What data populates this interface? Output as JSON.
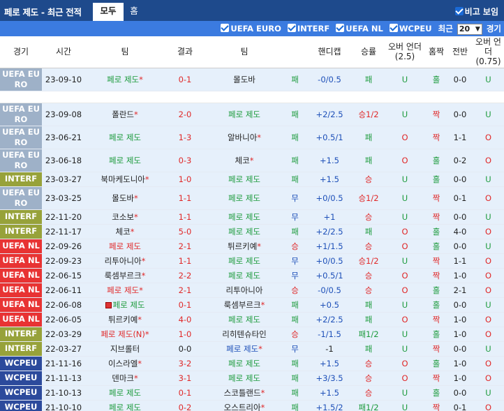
{
  "header": {
    "title": "페로 제도 - 최근 전적",
    "tabs": [
      "모두",
      "홈"
    ],
    "hide_compare_label": "비고 보임"
  },
  "filters": {
    "items": [
      "UEFA EURO",
      "INTERF",
      "UEFA NL",
      "WCPEU"
    ],
    "recent_label": "최근",
    "count_value": "20",
    "games_label": "경기"
  },
  "columns": [
    "경기",
    "시간",
    "팀",
    "결과",
    "팀",
    "핸디캡",
    "승률",
    "오버 언더 (2.5)",
    "홈짝",
    "전반",
    "오버 언더 (0.75)"
  ],
  "league_colors": {
    "UEFA EURO": "#9eb1c8",
    "INTERF": "#97a23a",
    "UEFA NL": "#e83333",
    "WCPEU": "#2c4a9c"
  },
  "matches": [
    {
      "league": "UEFA EURO",
      "date": "23-09-10",
      "home": "페로 제도",
      "home_mark": "*",
      "home_color": "g",
      "score": "0-1",
      "score_color": "r",
      "away": "몰도바",
      "away_mark": "",
      "away_color": "k",
      "res": "패",
      "res_color": "g",
      "handicap": "-0/0.5",
      "hc_color": "b",
      "win": "패",
      "win_color": "g",
      "ou": "U",
      "ou_color": "g",
      "oe": "홀",
      "oe_color": "g",
      "half": "0-0",
      "half_color": "k",
      "ou2": "U",
      "ou2_color": "g",
      "gap_after": true
    },
    {
      "league": "UEFA EURO",
      "date": "23-09-08",
      "home": "폴란드",
      "home_mark": "*",
      "home_color": "k",
      "score": "2-0",
      "score_color": "r",
      "away": "페로 제도",
      "away_mark": "",
      "away_color": "g",
      "res": "패",
      "res_color": "g",
      "handicap": "+2/2.5",
      "hc_color": "b",
      "win": "승1/2",
      "win_color": "r",
      "ou": "U",
      "ou_color": "g",
      "oe": "짝",
      "oe_color": "r",
      "half": "0-0",
      "half_color": "k",
      "ou2": "U",
      "ou2_color": "g"
    },
    {
      "league": "UEFA EURO",
      "date": "23-06-21",
      "home": "페로 제도",
      "home_mark": "",
      "home_color": "g",
      "score": "1-3",
      "score_color": "r",
      "away": "알바니아",
      "away_mark": "*",
      "away_color": "k",
      "res": "패",
      "res_color": "g",
      "handicap": "+0.5/1",
      "hc_color": "b",
      "win": "패",
      "win_color": "g",
      "ou": "O",
      "ou_color": "r",
      "oe": "짝",
      "oe_color": "r",
      "half": "1-1",
      "half_color": "k",
      "ou2": "O",
      "ou2_color": "r"
    },
    {
      "league": "UEFA EURO",
      "date": "23-06-18",
      "home": "페로 제도",
      "home_mark": "",
      "home_color": "g",
      "score": "0-3",
      "score_color": "r",
      "away": "체코",
      "away_mark": "*",
      "away_color": "k",
      "res": "패",
      "res_color": "g",
      "handicap": "+1.5",
      "hc_color": "b",
      "win": "패",
      "win_color": "g",
      "ou": "O",
      "ou_color": "r",
      "oe": "홀",
      "oe_color": "g",
      "half": "0-2",
      "half_color": "k",
      "ou2": "O",
      "ou2_color": "r"
    },
    {
      "league": "INTERF",
      "date": "23-03-27",
      "home": "북마케도니아",
      "home_mark": "*",
      "home_color": "k",
      "score": "1-0",
      "score_color": "r",
      "away": "페로 제도",
      "away_mark": "",
      "away_color": "g",
      "res": "패",
      "res_color": "g",
      "handicap": "+1.5",
      "hc_color": "b",
      "win": "승",
      "win_color": "r",
      "ou": "U",
      "ou_color": "g",
      "oe": "홀",
      "oe_color": "g",
      "half": "0-0",
      "half_color": "k",
      "ou2": "U",
      "ou2_color": "g"
    },
    {
      "league": "UEFA EURO",
      "date": "23-03-25",
      "home": "몰도바",
      "home_mark": "*",
      "home_color": "k",
      "score": "1-1",
      "score_color": "r",
      "away": "페로 제도",
      "away_mark": "",
      "away_color": "g",
      "res": "무",
      "res_color": "b",
      "handicap": "+0/0.5",
      "hc_color": "b",
      "win": "승1/2",
      "win_color": "r",
      "ou": "U",
      "ou_color": "g",
      "oe": "짝",
      "oe_color": "r",
      "half": "0-1",
      "half_color": "k",
      "ou2": "O",
      "ou2_color": "r"
    },
    {
      "league": "INTERF",
      "date": "22-11-20",
      "home": "코소보",
      "home_mark": "*",
      "home_color": "k",
      "score": "1-1",
      "score_color": "r",
      "away": "페로 제도",
      "away_mark": "",
      "away_color": "g",
      "res": "무",
      "res_color": "b",
      "handicap": "+1",
      "hc_color": "b",
      "win": "승",
      "win_color": "r",
      "ou": "U",
      "ou_color": "g",
      "oe": "짝",
      "oe_color": "r",
      "half": "0-0",
      "half_color": "k",
      "ou2": "U",
      "ou2_color": "g"
    },
    {
      "league": "INTERF",
      "date": "22-11-17",
      "home": "체코",
      "home_mark": "*",
      "home_color": "k",
      "score": "5-0",
      "score_color": "r",
      "away": "페로 제도",
      "away_mark": "",
      "away_color": "g",
      "res": "패",
      "res_color": "g",
      "handicap": "+2/2.5",
      "hc_color": "b",
      "win": "패",
      "win_color": "g",
      "ou": "O",
      "ou_color": "r",
      "oe": "홀",
      "oe_color": "g",
      "half": "4-0",
      "half_color": "k",
      "ou2": "O",
      "ou2_color": "r"
    },
    {
      "league": "UEFA NL",
      "date": "22-09-26",
      "home": "페로 제도",
      "home_mark": "",
      "home_color": "r",
      "score": "2-1",
      "score_color": "r",
      "away": "튀르키예",
      "away_mark": "*",
      "away_color": "k",
      "res": "승",
      "res_color": "r",
      "handicap": "+1/1.5",
      "hc_color": "b",
      "win": "승",
      "win_color": "r",
      "ou": "O",
      "ou_color": "r",
      "oe": "홀",
      "oe_color": "g",
      "half": "0-0",
      "half_color": "k",
      "ou2": "U",
      "ou2_color": "g"
    },
    {
      "league": "UEFA NL",
      "date": "22-09-23",
      "home": "리투아니아",
      "home_mark": "*",
      "home_color": "k",
      "score": "1-1",
      "score_color": "r",
      "away": "페로 제도",
      "away_mark": "",
      "away_color": "g",
      "res": "무",
      "res_color": "b",
      "handicap": "+0/0.5",
      "hc_color": "b",
      "win": "승1/2",
      "win_color": "r",
      "ou": "U",
      "ou_color": "g",
      "oe": "짝",
      "oe_color": "r",
      "half": "1-1",
      "half_color": "k",
      "ou2": "O",
      "ou2_color": "r"
    },
    {
      "league": "UEFA NL",
      "date": "22-06-15",
      "home": "룩셈부르크",
      "home_mark": "*",
      "home_color": "k",
      "score": "2-2",
      "score_color": "r",
      "away": "페로 제도",
      "away_mark": "",
      "away_color": "g",
      "res": "무",
      "res_color": "b",
      "handicap": "+0.5/1",
      "hc_color": "b",
      "win": "승",
      "win_color": "r",
      "ou": "O",
      "ou_color": "r",
      "oe": "짝",
      "oe_color": "r",
      "half": "1-0",
      "half_color": "k",
      "ou2": "O",
      "ou2_color": "r"
    },
    {
      "league": "UEFA NL",
      "date": "22-06-11",
      "home": "페로 제도",
      "home_mark": "*",
      "home_color": "r",
      "score": "2-1",
      "score_color": "r",
      "away": "리투아니아",
      "away_mark": "",
      "away_color": "k",
      "res": "승",
      "res_color": "r",
      "handicap": "-0/0.5",
      "hc_color": "b",
      "win": "승",
      "win_color": "r",
      "ou": "O",
      "ou_color": "r",
      "oe": "홀",
      "oe_color": "g",
      "half": "2-1",
      "half_color": "k",
      "ou2": "O",
      "ou2_color": "r"
    },
    {
      "league": "UEFA NL",
      "date": "22-06-08",
      "home": "페로 제도",
      "home_mark": "",
      "home_color": "g",
      "home_flag": true,
      "score": "0-1",
      "score_color": "r",
      "away": "룩셈부르크",
      "away_mark": "*",
      "away_color": "k",
      "res": "패",
      "res_color": "g",
      "handicap": "+0.5",
      "hc_color": "b",
      "win": "패",
      "win_color": "g",
      "ou": "U",
      "ou_color": "g",
      "oe": "홀",
      "oe_color": "g",
      "half": "0-0",
      "half_color": "k",
      "ou2": "U",
      "ou2_color": "g"
    },
    {
      "league": "UEFA NL",
      "date": "22-06-05",
      "home": "튀르키예",
      "home_mark": "*",
      "home_color": "k",
      "score": "4-0",
      "score_color": "r",
      "away": "페로 제도",
      "away_mark": "",
      "away_color": "g",
      "res": "패",
      "res_color": "g",
      "handicap": "+2/2.5",
      "hc_color": "b",
      "win": "패",
      "win_color": "g",
      "ou": "O",
      "ou_color": "r",
      "oe": "짝",
      "oe_color": "r",
      "half": "1-0",
      "half_color": "k",
      "ou2": "O",
      "ou2_color": "r"
    },
    {
      "league": "INTERF",
      "date": "22-03-29",
      "home": "페로 제도(N)",
      "home_mark": "*",
      "home_color": "r",
      "score": "1-0",
      "score_color": "r",
      "away": "리히텐슈타인",
      "away_mark": "",
      "away_color": "k",
      "res": "승",
      "res_color": "r",
      "handicap": "-1/1.5",
      "hc_color": "b",
      "win": "패1/2",
      "win_color": "g",
      "ou": "U",
      "ou_color": "g",
      "oe": "홀",
      "oe_color": "g",
      "half": "1-0",
      "half_color": "k",
      "ou2": "O",
      "ou2_color": "r"
    },
    {
      "league": "INTERF",
      "date": "22-03-27",
      "home": "지브롤터",
      "home_mark": "",
      "home_color": "k",
      "score": "0-0",
      "score_color": "k",
      "away": "페로 제도",
      "away_mark": "*",
      "away_color": "b",
      "res": "무",
      "res_color": "b",
      "handicap": "-1",
      "hc_color": "k",
      "win": "패",
      "win_color": "g",
      "ou": "U",
      "ou_color": "g",
      "oe": "짝",
      "oe_color": "r",
      "half": "0-0",
      "half_color": "k",
      "ou2": "U",
      "ou2_color": "g"
    },
    {
      "league": "WCPEU",
      "date": "21-11-16",
      "home": "이스라엘",
      "home_mark": "*",
      "home_color": "k",
      "score": "3-2",
      "score_color": "r",
      "away": "페로 제도",
      "away_mark": "",
      "away_color": "g",
      "res": "패",
      "res_color": "g",
      "handicap": "+1.5",
      "hc_color": "b",
      "win": "승",
      "win_color": "r",
      "ou": "O",
      "ou_color": "r",
      "oe": "홀",
      "oe_color": "g",
      "half": "1-0",
      "half_color": "k",
      "ou2": "O",
      "ou2_color": "r"
    },
    {
      "league": "WCPEU",
      "date": "21-11-13",
      "home": "덴마크",
      "home_mark": "*",
      "home_color": "k",
      "score": "3-1",
      "score_color": "r",
      "away": "페로 제도",
      "away_mark": "",
      "away_color": "g",
      "res": "패",
      "res_color": "g",
      "handicap": "+3/3.5",
      "hc_color": "b",
      "win": "승",
      "win_color": "r",
      "ou": "O",
      "ou_color": "r",
      "oe": "짝",
      "oe_color": "r",
      "half": "1-0",
      "half_color": "k",
      "ou2": "O",
      "ou2_color": "r"
    },
    {
      "league": "WCPEU",
      "date": "21-10-13",
      "home": "페로 제도",
      "home_mark": "",
      "home_color": "g",
      "score": "0-1",
      "score_color": "r",
      "away": "스코틀랜드",
      "away_mark": "*",
      "away_color": "k",
      "res": "패",
      "res_color": "g",
      "handicap": "+1.5",
      "hc_color": "b",
      "win": "승",
      "win_color": "r",
      "ou": "U",
      "ou_color": "g",
      "oe": "홀",
      "oe_color": "g",
      "half": "0-0",
      "half_color": "k",
      "ou2": "U",
      "ou2_color": "g"
    },
    {
      "league": "WCPEU",
      "date": "21-10-10",
      "home": "페로 제도",
      "home_mark": "",
      "home_color": "g",
      "score": "0-2",
      "score_color": "r",
      "away": "오스트리아",
      "away_mark": "*",
      "away_color": "k",
      "res": "패",
      "res_color": "g",
      "handicap": "+1.5/2",
      "hc_color": "b",
      "win": "패1/2",
      "win_color": "g",
      "ou": "U",
      "ou_color": "g",
      "oe": "짝",
      "oe_color": "r",
      "half": "0-1",
      "half_color": "k",
      "ou2": "O",
      "ou2_color": "r"
    }
  ]
}
